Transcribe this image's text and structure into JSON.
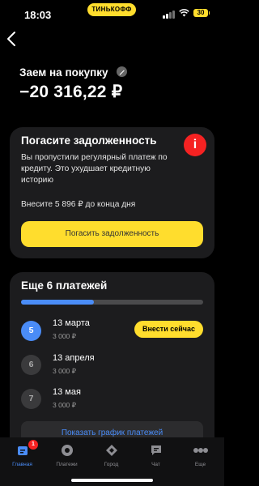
{
  "status": {
    "time": "18:03",
    "brand": "ТИНЬКОФФ",
    "battery": "30"
  },
  "loan": {
    "title": "Заем на покупку",
    "amount": "−20 316,22 ₽"
  },
  "debt_card": {
    "title": "Погасите задолженность",
    "description": "Вы пропустили регулярный платеж по кредиту. Это ухудшает кредитную историю",
    "pay_text": "Внесите 5 896 ₽ до конца дня",
    "button": "Погасить задолженность",
    "alert_symbol": "i"
  },
  "payments_card": {
    "title": "Еще 6 платежей",
    "progress": 0.4,
    "pay_now": "Внести сейчас",
    "schedule_button": "Показать график платежей",
    "items": [
      {
        "num": "5",
        "date": "13 марта",
        "amount": "3 000 ₽",
        "active": true
      },
      {
        "num": "6",
        "date": "13 апреля",
        "amount": "3 000 ₽",
        "active": false
      },
      {
        "num": "7",
        "date": "13 мая",
        "amount": "3 000 ₽",
        "active": false
      }
    ]
  },
  "tabs": [
    {
      "label": "Главная",
      "icon": "home-icon",
      "active": true,
      "badge": "1"
    },
    {
      "label": "Платежи",
      "icon": "payments-icon",
      "active": false
    },
    {
      "label": "Город",
      "icon": "city-icon",
      "active": false
    },
    {
      "label": "Чат",
      "icon": "chat-icon",
      "active": false
    },
    {
      "label": "Еще",
      "icon": "more-icon",
      "active": false
    }
  ],
  "colors": {
    "accent": "#ffdd2d",
    "blue": "#4a8cf7",
    "alert": "#f52222",
    "card": "#1c1c1e"
  }
}
